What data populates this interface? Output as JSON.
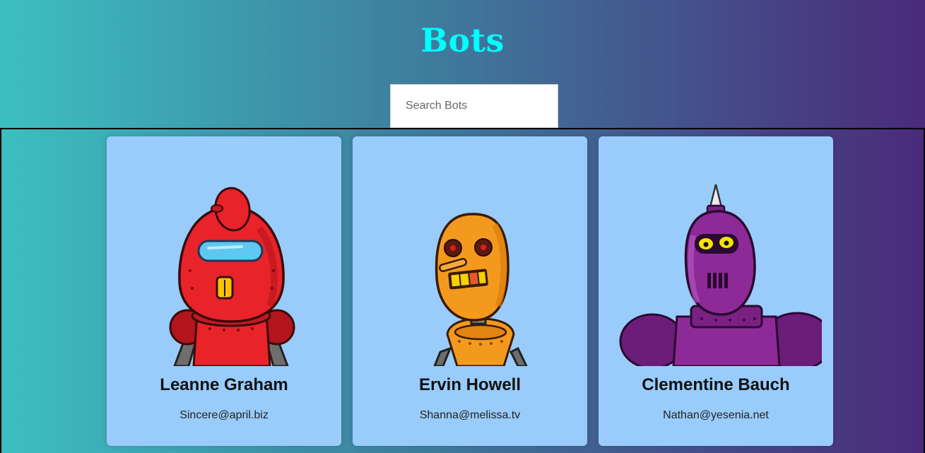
{
  "header": {
    "title": "Bots"
  },
  "search": {
    "placeholder": "Search Bots",
    "value": ""
  },
  "bots": [
    {
      "name": "Leanne Graham",
      "email": "Sincere@april.biz",
      "icon": "red-robot-icon",
      "color": "#e8232a"
    },
    {
      "name": "Ervin Howell",
      "email": "Shanna@melissa.tv",
      "icon": "orange-robot-icon",
      "color": "#f39a1e"
    },
    {
      "name": "Clementine Bauch",
      "email": "Nathan@yesenia.net",
      "icon": "purple-robot-icon",
      "color": "#8e2a98"
    }
  ],
  "colors": {
    "title": "#00ffff",
    "card": "#99ccfb",
    "gradient_start": "#3cbfc0",
    "gradient_end": "#4a2a7b"
  }
}
